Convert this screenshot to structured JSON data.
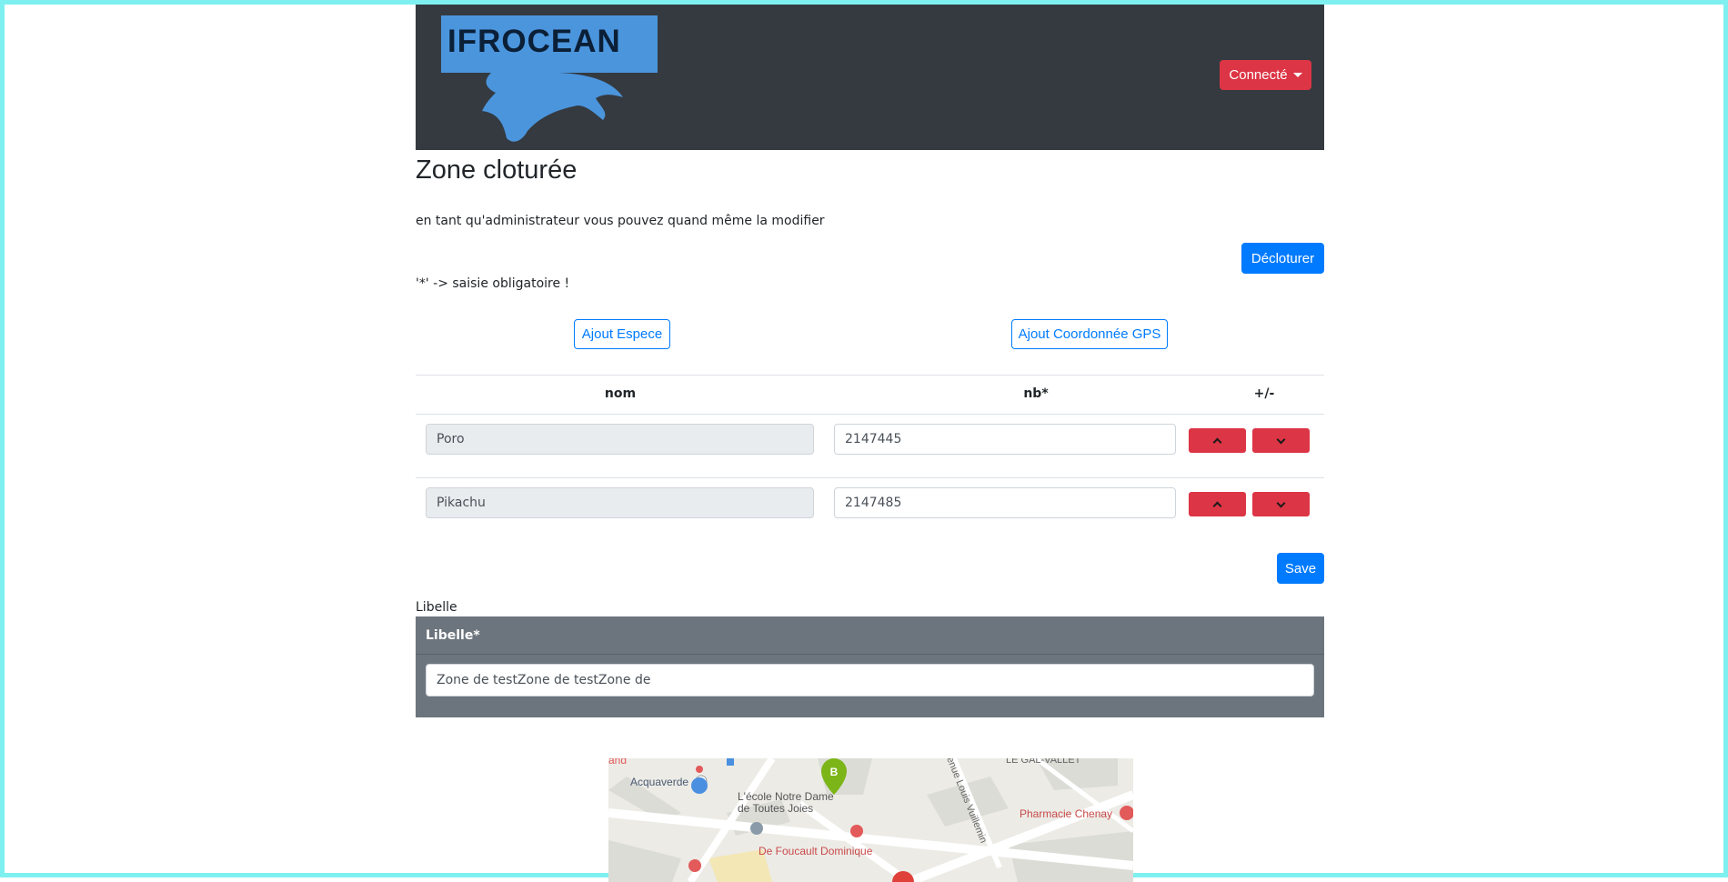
{
  "navbar": {
    "logo_text": "IFROCEAN",
    "user_menu_label": "Connecté"
  },
  "page": {
    "title": "Zone cloturée",
    "admin_note": "en tant qu'administrateur vous pouvez quand même la modifier",
    "declore_label": "Décloturer",
    "required_note": "'*' -> saisie obligatoire !",
    "add_species_label": "Ajout Espece",
    "add_gps_label": "Ajout Coordonnée GPS",
    "save_label": "Save"
  },
  "table": {
    "headers": [
      "nom",
      "nb*",
      "+/-"
    ],
    "rows": [
      {
        "nom": "Poro",
        "nb": "2147445"
      },
      {
        "nom": "Pikachu",
        "nb": "2147485"
      }
    ]
  },
  "libelle": {
    "section_label": "Libelle",
    "card_header": "Libelle*",
    "value": "Zone de testZone de testZone de"
  },
  "map": {
    "labels": {
      "aquaverde": "Acquaverde",
      "ecole_line1": "L'école Notre Dame",
      "ecole_line2": "de Toutes Joies",
      "foucault": "De Foucault Dominique",
      "pharmacie": "Pharmacie Chenay",
      "le_gal_vallet": "LE GAL-VALLET",
      "avenue": "enue Louis Vuillemin",
      "marker_b": "B",
      "fragment": "and"
    },
    "colors": {
      "marker_green": "#7cb518",
      "poi_red": "#e25a5a",
      "poi_blue": "#4a8fe0",
      "road": "#ffffff",
      "block": "#dcdcd7"
    }
  }
}
